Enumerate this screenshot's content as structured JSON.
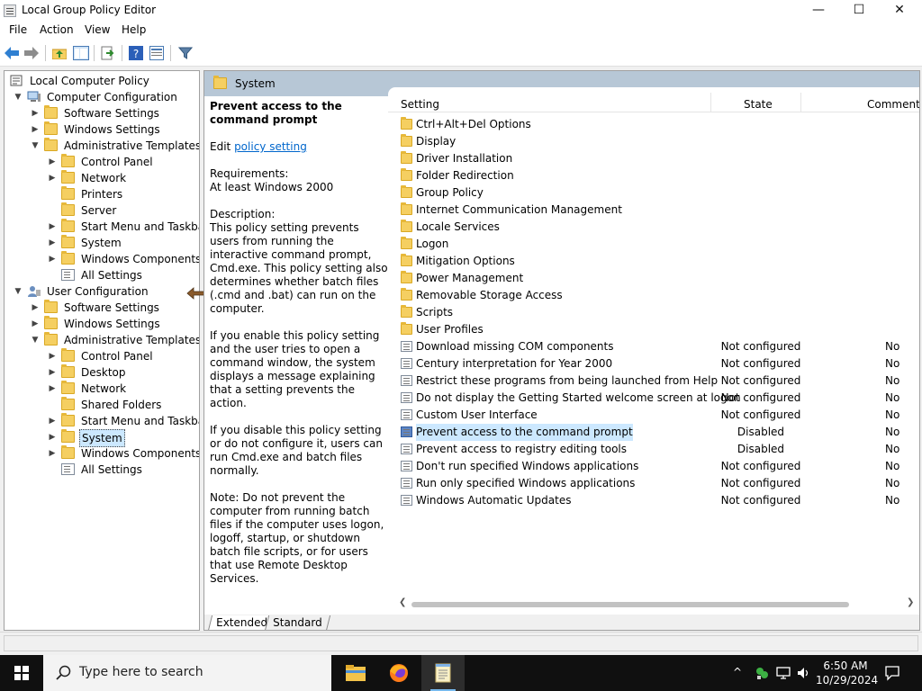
{
  "window": {
    "title": "Local Group Policy Editor",
    "minimize": "—",
    "maximize": "☐",
    "close": "✕"
  },
  "menu": [
    "File",
    "Action",
    "View",
    "Help"
  ],
  "toolbar_icons": [
    "back-arrow-icon",
    "forward-arrow-icon",
    "up-folder-icon",
    "show-hide-tree-icon",
    "export-list-icon",
    "help-icon",
    "properties-icon",
    "filter-icon"
  ],
  "tree": [
    {
      "label": "Local Computer Policy",
      "icon": "policy-icon",
      "expand": ""
    },
    {
      "label": "Computer Configuration",
      "icon": "computer-icon",
      "expand": "down"
    },
    {
      "label": "Software Settings",
      "icon": "folder-icon",
      "expand": "right"
    },
    {
      "label": "Windows Settings",
      "icon": "folder-icon",
      "expand": "right"
    },
    {
      "label": "Administrative Templates",
      "icon": "folder-icon",
      "expand": "down"
    },
    {
      "label": "Control Panel",
      "icon": "folder-icon",
      "expand": "right"
    },
    {
      "label": "Network",
      "icon": "folder-icon",
      "expand": "right"
    },
    {
      "label": "Printers",
      "icon": "folder-icon",
      "expand": ""
    },
    {
      "label": "Server",
      "icon": "folder-icon",
      "expand": ""
    },
    {
      "label": "Start Menu and Taskbar",
      "icon": "folder-icon",
      "expand": "right"
    },
    {
      "label": "System",
      "icon": "folder-icon",
      "expand": "right"
    },
    {
      "label": "Windows Components",
      "icon": "folder-icon",
      "expand": "right"
    },
    {
      "label": "All Settings",
      "icon": "settings-list-icon",
      "expand": ""
    },
    {
      "label": "User Configuration",
      "icon": "user-icon",
      "expand": "down"
    },
    {
      "label": "Software Settings",
      "icon": "folder-icon",
      "expand": "right"
    },
    {
      "label": "Windows Settings",
      "icon": "folder-icon",
      "expand": "right"
    },
    {
      "label": "Administrative Templates",
      "icon": "folder-icon",
      "expand": "down"
    },
    {
      "label": "Control Panel",
      "icon": "folder-icon",
      "expand": "right"
    },
    {
      "label": "Desktop",
      "icon": "folder-icon",
      "expand": "right"
    },
    {
      "label": "Network",
      "icon": "folder-icon",
      "expand": "right"
    },
    {
      "label": "Shared Folders",
      "icon": "folder-icon",
      "expand": ""
    },
    {
      "label": "Start Menu and Taskbar",
      "icon": "folder-icon",
      "expand": "right"
    },
    {
      "label": "System",
      "icon": "folder-icon",
      "expand": "right",
      "selected": true
    },
    {
      "label": "Windows Components",
      "icon": "folder-icon",
      "expand": "right"
    },
    {
      "label": "All Settings",
      "icon": "settings-list-icon",
      "expand": ""
    }
  ],
  "right_header": "System",
  "description": {
    "title": "Prevent access to the command prompt",
    "edit_prefix": "Edit ",
    "edit_link": "policy setting ",
    "requirements_label": "Requirements:",
    "requirements": "At least Windows 2000",
    "description_label": "Description:",
    "p1": "This policy setting prevents users from running the interactive command prompt, Cmd.exe.  This policy setting also determines whether batch files (.cmd and .bat) can run on the computer.",
    "p2": "If you enable this policy setting and the user tries to open a command window, the system displays a message explaining that a setting prevents the action.",
    "p3": "If you disable this policy setting or do not configure it, users can run Cmd.exe and batch files normally.",
    "p4": "Note: Do not prevent the computer from running batch files if the computer uses logon, logoff, startup, or shutdown batch file scripts, or for users that use Remote Desktop Services."
  },
  "columns": {
    "setting": "Setting",
    "state": "State",
    "comment": "Comment"
  },
  "rows": [
    {
      "name": "Ctrl+Alt+Del Options",
      "type": "folder",
      "state": "",
      "comment": ""
    },
    {
      "name": "Display",
      "type": "folder",
      "state": "",
      "comment": ""
    },
    {
      "name": "Driver Installation",
      "type": "folder",
      "state": "",
      "comment": ""
    },
    {
      "name": "Folder Redirection",
      "type": "folder",
      "state": "",
      "comment": ""
    },
    {
      "name": "Group Policy",
      "type": "folder",
      "state": "",
      "comment": ""
    },
    {
      "name": "Internet Communication Management",
      "type": "folder",
      "state": "",
      "comment": ""
    },
    {
      "name": "Locale Services",
      "type": "folder",
      "state": "",
      "comment": ""
    },
    {
      "name": "Logon",
      "type": "folder",
      "state": "",
      "comment": ""
    },
    {
      "name": "Mitigation Options",
      "type": "folder",
      "state": "",
      "comment": ""
    },
    {
      "name": "Power Management",
      "type": "folder",
      "state": "",
      "comment": ""
    },
    {
      "name": "Removable Storage Access",
      "type": "folder",
      "state": "",
      "comment": ""
    },
    {
      "name": "Scripts",
      "type": "folder",
      "state": "",
      "comment": ""
    },
    {
      "name": "User Profiles",
      "type": "folder",
      "state": "",
      "comment": ""
    },
    {
      "name": "Download missing COM components",
      "type": "setting",
      "state": "Not configured",
      "comment": "No"
    },
    {
      "name": "Century interpretation for Year 2000",
      "type": "setting",
      "state": "Not configured",
      "comment": "No"
    },
    {
      "name": "Restrict these programs from being launched from Help",
      "type": "setting",
      "state": "Not configured",
      "comment": "No"
    },
    {
      "name": "Do not display the Getting Started welcome screen at logon",
      "type": "setting",
      "state": "Not configured",
      "comment": "No"
    },
    {
      "name": "Custom User Interface",
      "type": "setting",
      "state": "Not configured",
      "comment": "No"
    },
    {
      "name": "Prevent access to the command prompt",
      "type": "setting",
      "state": "Disabled",
      "comment": "No",
      "selected": true
    },
    {
      "name": "Prevent access to registry editing tools",
      "type": "setting",
      "state": "Disabled",
      "comment": "No"
    },
    {
      "name": "Don't run specified Windows applications",
      "type": "setting",
      "state": "Not configured",
      "comment": "No"
    },
    {
      "name": "Run only specified Windows applications",
      "type": "setting",
      "state": "Not configured",
      "comment": "No"
    },
    {
      "name": "Windows Automatic Updates",
      "type": "setting",
      "state": "Not configured",
      "comment": "No"
    }
  ],
  "tabs": [
    "Extended",
    "Standard"
  ],
  "taskbar": {
    "search_placeholder": "Type here to search",
    "apps": [
      "file-explorer-icon",
      "firefox-icon",
      "notepad-icon"
    ],
    "time": "6:50 AM",
    "date": "10/29/2024",
    "tray_up": "^"
  },
  "colors": {
    "accent": "#0066cc",
    "header_band": "#b7c7d6",
    "selection": "#cce8ff",
    "taskbar": "#101010"
  }
}
